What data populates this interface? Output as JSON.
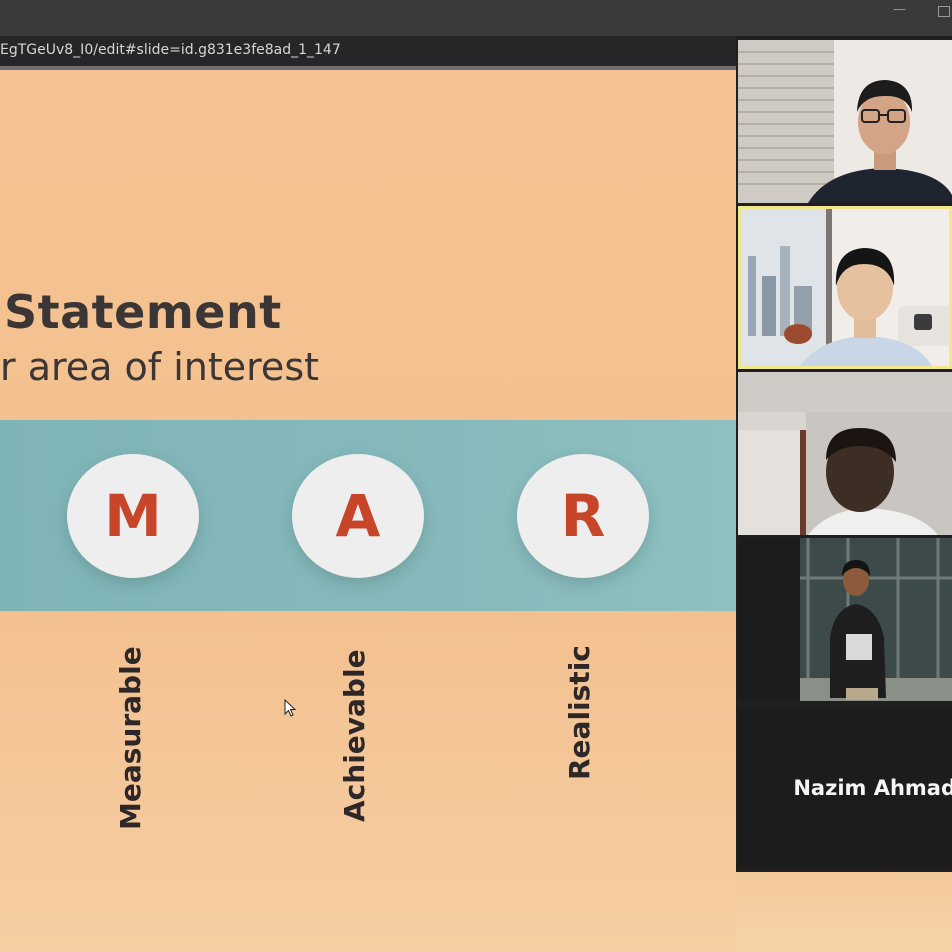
{
  "browser": {
    "url": "EgTGeUv8_I0/edit#slide=id.g831e3fe8ad_1_147",
    "minimize_glyph": "—"
  },
  "slide": {
    "title": "Statement",
    "subtitle": "r area of interest",
    "letters": [
      {
        "letter": "M",
        "word": "Measurable"
      },
      {
        "letter": "A",
        "word": "Achievable"
      },
      {
        "letter": "R",
        "word": "Realistic"
      }
    ],
    "colors": {
      "background": "#f2c597",
      "band": "#86b9bb",
      "circle": "#efeeee",
      "letter": "#c7462a",
      "text": "#3b3535"
    }
  },
  "video_panel": {
    "participants": [
      {
        "id": "participant-1",
        "description": "man with glasses, window blinds"
      },
      {
        "id": "participant-2",
        "description": "man in apartment, city view",
        "active_speaker": true
      },
      {
        "id": "participant-3",
        "description": "man in dim room"
      },
      {
        "id": "participant-4",
        "description": "man in hoodie standing"
      }
    ],
    "name_tile": "Nazim Ahmad",
    "active_outline_color": "#f2e68f"
  }
}
